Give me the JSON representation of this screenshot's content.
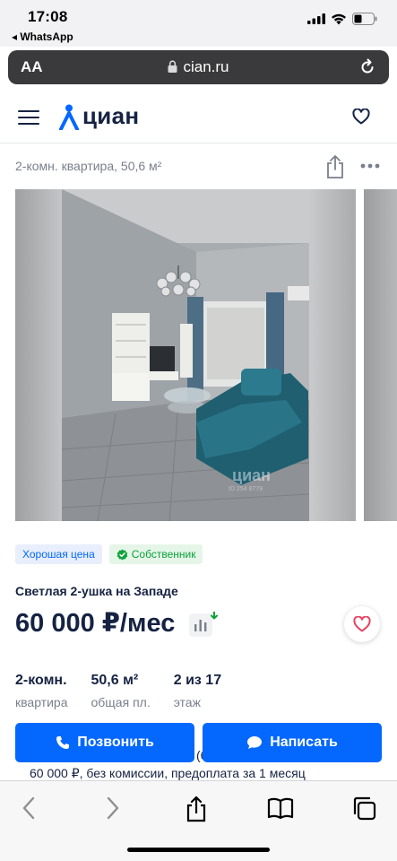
{
  "status_bar": {
    "time": "17:08",
    "back_app": "◂ WhatsApp"
  },
  "browser": {
    "text_size": "AA",
    "domain": "cian.ru"
  },
  "site": {
    "logo_text": "циан"
  },
  "listing": {
    "subtitle": "2-комн. квартира, 50,6 м²",
    "badges": {
      "good_price": "Хорошая цена",
      "owner": "Собственник"
    },
    "title": "Светлая 2-ушка на Западе",
    "price": "60 000 ₽/мес",
    "facts": [
      {
        "value": "2-комн.",
        "label": "квартира"
      },
      {
        "value": "50,6 м²",
        "label": "общая пл."
      },
      {
        "value": "2 из 17",
        "label": "этаж"
      }
    ],
    "photo_watermark": "циан",
    "photo_watermark_id": "ID 254 8779"
  },
  "actions": {
    "call": "Позвонить",
    "write": "Написать",
    "overflow_fragment": "(6"
  },
  "terms_text": "60 000 ₽, без комиссии, предоплата за 1 месяц",
  "colors": {
    "accent": "#0468ff",
    "owner_green": "#0ea23a",
    "text": "#152242",
    "favorite_red": "#e84260"
  }
}
